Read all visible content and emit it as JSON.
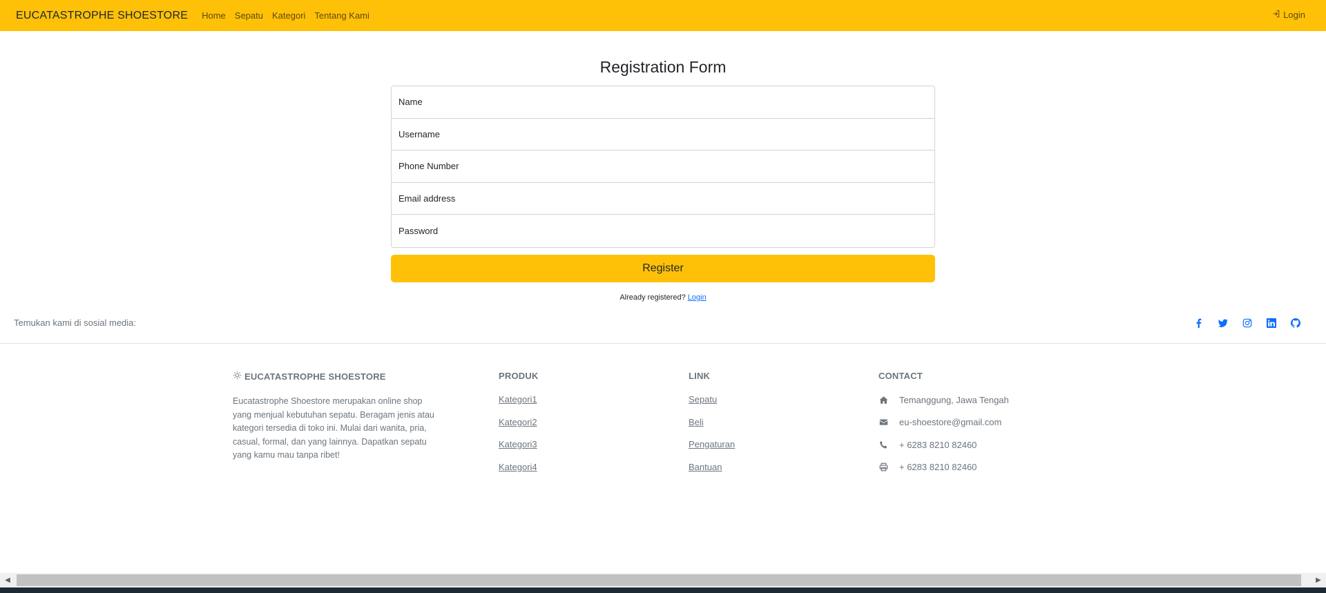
{
  "navbar": {
    "brand": "EUCATASTROPHE SHOESTORE",
    "links": [
      "Home",
      "Sepatu",
      "Kategori",
      "Tentang Kami"
    ],
    "login": "Login"
  },
  "form": {
    "title": "Registration Form",
    "fields": {
      "name": "Name",
      "username": "Username",
      "phone": "Phone Number",
      "email": "Email address",
      "password": "Password"
    },
    "register_label": "Register",
    "already_text": "Already registered?",
    "login_link": "Login"
  },
  "social": {
    "text": "Temukan kami di sosial media:",
    "icons": [
      "facebook-icon",
      "twitter-icon",
      "instagram-icon",
      "linkedin-icon",
      "github-icon"
    ],
    "icon_color": "#0d6efd"
  },
  "footer": {
    "brand": "EUCATASTROPHE SHOESTORE",
    "about": "Eucatastrophe Shoestore merupakan online shop yang menjual kebutuhan sepatu. Beragam jenis atau kategori tersedia di toko ini. Mulai dari wanita, pria, casual, formal, dan yang lainnya. Dapatkan sepatu yang kamu mau tanpa ribet!",
    "produk": {
      "title": "PRODUK",
      "items": [
        "Kategori1",
        "Kategori2",
        "Kategori3",
        "Kategori4"
      ]
    },
    "link": {
      "title": "LINK",
      "items": [
        "Sepatu",
        "Beli",
        "Pengaturan",
        "Bantuan"
      ]
    },
    "contact": {
      "title": "CONTACT",
      "address": "Temanggung, Jawa Tengah",
      "email": "eu-shoestore@gmail.com",
      "phone": "+ 6283 8210 82460",
      "fax": "+ 6283 8210 82460"
    }
  },
  "colors": {
    "accent": "#ffc107",
    "muted": "#6c757d",
    "link": "#0d6efd"
  }
}
